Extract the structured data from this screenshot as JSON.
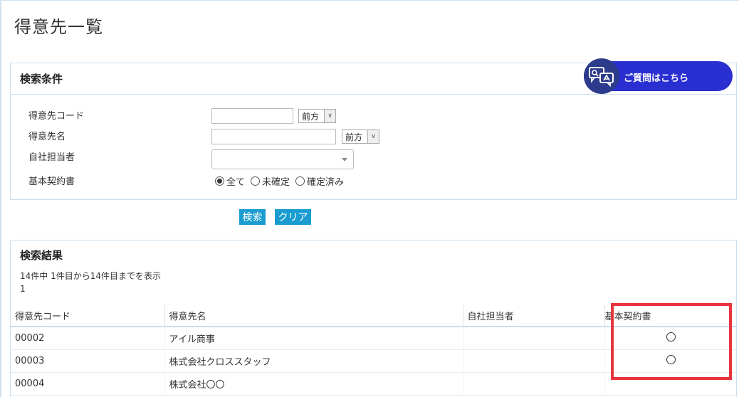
{
  "page": {
    "title": "得意先一覧"
  },
  "help": {
    "label": "ご質問はこちら",
    "icon": "chat-translate-icon"
  },
  "search": {
    "header": "検索条件",
    "fields": {
      "code_label": "得意先コード",
      "code_value": "",
      "code_match": "前方",
      "name_label": "得意先名",
      "name_value": "",
      "name_match": "前方",
      "staff_label": "自社担当者",
      "staff_value": "",
      "contract_label": "基本契約書",
      "contract_options": [
        "全て",
        "未確定",
        "確定済み"
      ],
      "contract_selected": "全て"
    },
    "buttons": {
      "search": "検索",
      "clear": "クリア"
    }
  },
  "results": {
    "header": "検索結果",
    "summary": "14件中 1件目から14件目までを表示",
    "page": "1",
    "columns": [
      "得意先コード",
      "得意先名",
      "自社担当者",
      "基本契約書"
    ],
    "rows": [
      {
        "code": "00002",
        "name": "アイル商事",
        "staff": "",
        "contract": "○"
      },
      {
        "code": "00003",
        "name": "株式会社クロススタッフ",
        "staff": "",
        "contract": "○"
      },
      {
        "code": "00004",
        "name": "株式会社〇〇",
        "staff": "",
        "contract": ""
      }
    ]
  },
  "colors": {
    "accent": "#1a9cd0",
    "help_bg": "#2a2fd1",
    "highlight": "#e8343f",
    "border": "#c9dff0"
  }
}
